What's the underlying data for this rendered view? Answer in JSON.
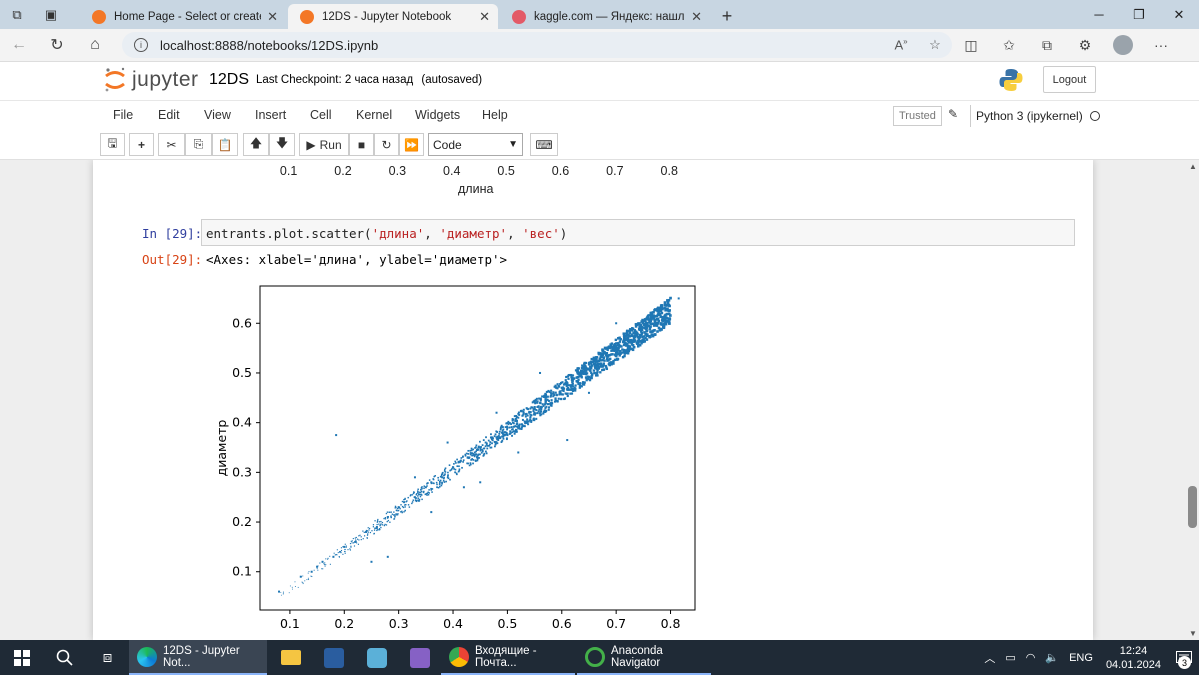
{
  "browser": {
    "tabs": [
      {
        "label": "Home Page - Select or create a n",
        "active": false,
        "icon": "jupyter-tab-icon"
      },
      {
        "label": "12DS - Jupyter Notebook",
        "active": true,
        "icon": "jupyter-tab-icon"
      },
      {
        "label": "kaggle.com — Яндекс: нашлось",
        "active": false,
        "icon": "yandex-tab-icon"
      }
    ],
    "url": "localhost:8888/notebooks/12DS.ipynb"
  },
  "jupyter": {
    "logo_text": "jupyter",
    "notebook_name": "12DS",
    "checkpoint": "Last Checkpoint: 2 часа назад",
    "autosave": "(autosaved)",
    "logout_label": "Logout",
    "menu": [
      "File",
      "Edit",
      "View",
      "Insert",
      "Cell",
      "Kernel",
      "Widgets",
      "Help"
    ],
    "trusted_label": "Trusted",
    "kernel_name": "Python 3 (ipykernel)",
    "toolbar": {
      "run_label": "Run",
      "cell_type": "Code"
    }
  },
  "previous_output": {
    "xticks": [
      "0.1",
      "0.2",
      "0.3",
      "0.4",
      "0.5",
      "0.6",
      "0.7",
      "0.8"
    ],
    "xlabel": "длина"
  },
  "cell": {
    "in_prompt": "In [29]:",
    "code_prefix": "entrants.plot.scatter(",
    "arg1": "'длина'",
    "sep1": ", ",
    "arg2": "'диаметр'",
    "sep2": ", ",
    "arg3": "'вес'",
    "code_suffix": ")",
    "out_prompt": "Out[29]:",
    "output_text": "<Axes: xlabel='длина', ylabel='диаметр'>"
  },
  "chart_data": {
    "type": "scatter",
    "xlabel": "длина",
    "ylabel": "диаметр",
    "xlim": [
      0.045,
      0.845
    ],
    "ylim": [
      0.023,
      0.675
    ],
    "xticks": [
      0.1,
      0.2,
      0.3,
      0.4,
      0.5,
      0.6,
      0.7,
      0.8
    ],
    "yticks": [
      0.1,
      0.2,
      0.3,
      0.4,
      0.5,
      0.6
    ],
    "color": "#1f77b4",
    "grid": false,
    "points": [
      [
        0.08,
        0.06
      ],
      [
        0.12,
        0.09
      ],
      [
        0.14,
        0.1
      ],
      [
        0.15,
        0.11
      ],
      [
        0.16,
        0.12
      ],
      [
        0.18,
        0.13
      ],
      [
        0.2,
        0.15
      ],
      [
        0.22,
        0.16
      ],
      [
        0.24,
        0.18
      ],
      [
        0.26,
        0.19
      ],
      [
        0.28,
        0.21
      ],
      [
        0.3,
        0.23
      ],
      [
        0.31,
        0.24
      ],
      [
        0.33,
        0.25
      ],
      [
        0.35,
        0.27
      ],
      [
        0.36,
        0.28
      ],
      [
        0.38,
        0.29
      ],
      [
        0.4,
        0.31
      ],
      [
        0.41,
        0.32
      ],
      [
        0.43,
        0.33
      ],
      [
        0.44,
        0.34
      ],
      [
        0.45,
        0.35
      ],
      [
        0.46,
        0.36
      ],
      [
        0.47,
        0.37
      ],
      [
        0.48,
        0.37
      ],
      [
        0.49,
        0.38
      ],
      [
        0.5,
        0.39
      ],
      [
        0.51,
        0.4
      ],
      [
        0.52,
        0.41
      ],
      [
        0.53,
        0.42
      ],
      [
        0.54,
        0.42
      ],
      [
        0.55,
        0.43
      ],
      [
        0.56,
        0.44
      ],
      [
        0.57,
        0.45
      ],
      [
        0.58,
        0.46
      ],
      [
        0.59,
        0.47
      ],
      [
        0.6,
        0.47
      ],
      [
        0.61,
        0.48
      ],
      [
        0.62,
        0.49
      ],
      [
        0.63,
        0.5
      ],
      [
        0.64,
        0.51
      ],
      [
        0.65,
        0.52
      ],
      [
        0.66,
        0.53
      ],
      [
        0.67,
        0.54
      ],
      [
        0.68,
        0.55
      ],
      [
        0.7,
        0.56
      ],
      [
        0.72,
        0.58
      ],
      [
        0.74,
        0.6
      ],
      [
        0.76,
        0.61
      ],
      [
        0.78,
        0.63
      ],
      [
        0.815,
        0.65
      ],
      [
        0.185,
        0.375
      ],
      [
        0.61,
        0.365
      ],
      [
        0.28,
        0.13
      ],
      [
        0.25,
        0.12
      ],
      [
        0.45,
        0.28
      ],
      [
        0.52,
        0.34
      ],
      [
        0.39,
        0.36
      ],
      [
        0.42,
        0.27
      ],
      [
        0.65,
        0.46
      ],
      [
        0.7,
        0.6
      ],
      [
        0.56,
        0.5
      ],
      [
        0.48,
        0.42
      ],
      [
        0.36,
        0.22
      ],
      [
        0.33,
        0.29
      ]
    ]
  },
  "taskbar": {
    "apps": [
      {
        "label": "12DS - Jupyter Not...",
        "active": true,
        "icon": "edge-icon"
      },
      {
        "label": "Входящие - Почта...",
        "active": false,
        "icon": "chrome-icon"
      },
      {
        "label": "Anaconda Navigator",
        "active": false,
        "icon": "anaconda-icon"
      }
    ],
    "lang": "ENG",
    "time": "12:24",
    "date": "04.01.2024",
    "notifications": "3"
  }
}
